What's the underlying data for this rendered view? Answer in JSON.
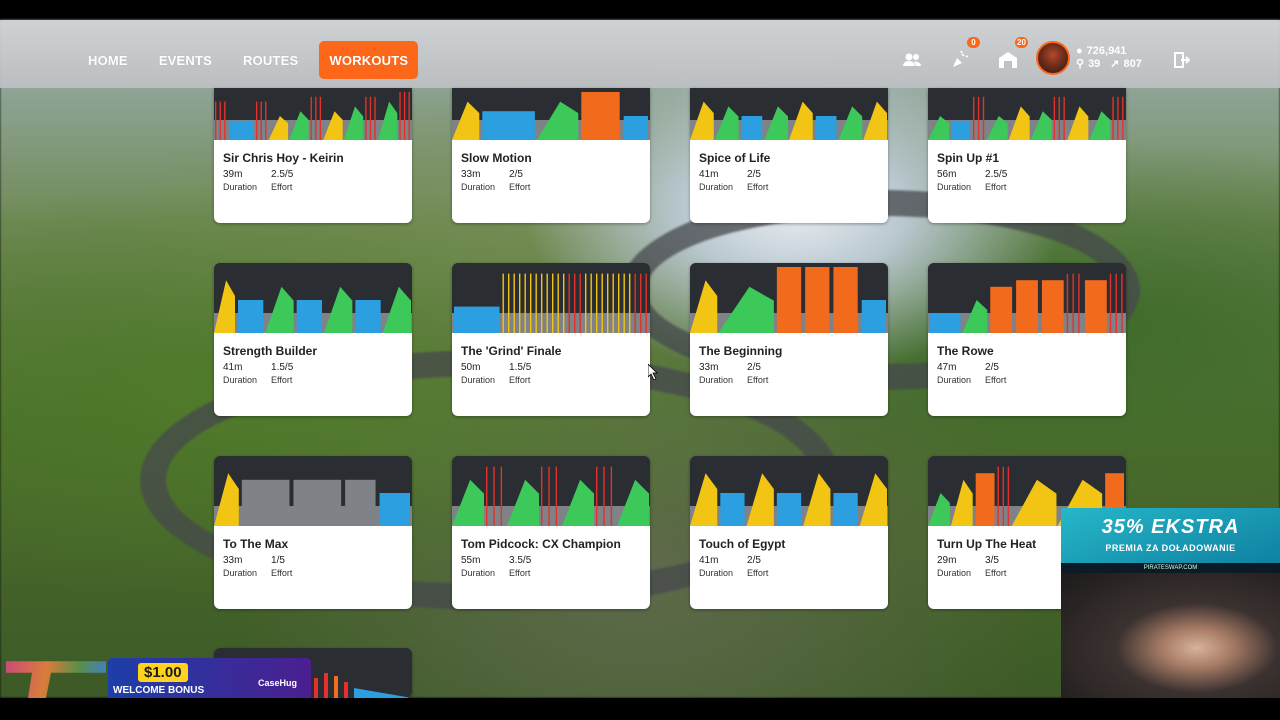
{
  "nav": {
    "tabs": [
      {
        "label": "HOME",
        "active": false
      },
      {
        "label": "EVENTS",
        "active": false
      },
      {
        "label": "ROUTES",
        "active": false
      },
      {
        "label": "WORKOUTS",
        "active": true
      }
    ],
    "icons": [
      {
        "name": "friends-icon",
        "badge": ""
      },
      {
        "name": "notifications-icon",
        "badge": "0"
      },
      {
        "name": "garage-icon",
        "badge": "20"
      }
    ],
    "stats": {
      "drops": "726,941",
      "level": "39",
      "distance": "807"
    },
    "accent": "#fc6719"
  },
  "workouts": [
    {
      "title": "Sir Chris Hoy - Keirin",
      "duration": "39m",
      "duration_label": "Duration",
      "effort": "2.5/5",
      "effort_label": "Effort"
    },
    {
      "title": "Slow Motion",
      "duration": "33m",
      "duration_label": "Duration",
      "effort": "2/5",
      "effort_label": "Effort"
    },
    {
      "title": "Spice of Life",
      "duration": "41m",
      "duration_label": "Duration",
      "effort": "2/5",
      "effort_label": "Effort"
    },
    {
      "title": "Spin Up #1",
      "duration": "56m",
      "duration_label": "Duration",
      "effort": "2.5/5",
      "effort_label": "Effort"
    },
    {
      "title": "Strength Builder",
      "duration": "41m",
      "duration_label": "Duration",
      "effort": "1.5/5",
      "effort_label": "Effort"
    },
    {
      "title": "The 'Grind' Finale",
      "duration": "50m",
      "duration_label": "Duration",
      "effort": "1.5/5",
      "effort_label": "Effort"
    },
    {
      "title": "The Beginning",
      "duration": "33m",
      "duration_label": "Duration",
      "effort": "2/5",
      "effort_label": "Effort"
    },
    {
      "title": "The Rowe",
      "duration": "47m",
      "duration_label": "Duration",
      "effort": "2/5",
      "effort_label": "Effort"
    },
    {
      "title": "To The Max",
      "duration": "33m",
      "duration_label": "Duration",
      "effort": "1/5",
      "effort_label": "Effort"
    },
    {
      "title": "Tom Pidcock: CX Champion",
      "duration": "55m",
      "duration_label": "Duration",
      "effort": "3.5/5",
      "effort_label": "Effort"
    },
    {
      "title": "Touch of Egypt",
      "duration": "41m",
      "duration_label": "Duration",
      "effort": "2/5",
      "effort_label": "Effort"
    },
    {
      "title": "Turn Up The Heat",
      "duration": "29m",
      "duration_label": "Duration",
      "effort": "3/5",
      "effort_label": "Effort"
    }
  ],
  "zone_colors": {
    "z1": "#7f8287",
    "z2": "#2b9fe0",
    "z3": "#3cc95a",
    "z4": "#f2c414",
    "z5": "#f26a1b",
    "z6": "#e5312b"
  },
  "overlays": {
    "promo_title": "35% EKSTRA",
    "promo_sub": "PREMIA ZA DOŁADOWANIE",
    "promo_site": "PIRATESWAP.COM",
    "bonus_amount": "$1.00",
    "bonus_text": "WELCOME BONUS",
    "bonus_brand": "CaseHug"
  }
}
